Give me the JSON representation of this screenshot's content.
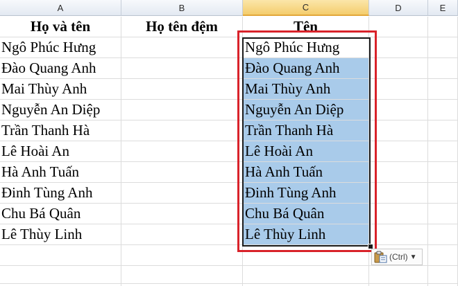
{
  "columns": [
    "A",
    "B",
    "C",
    "D",
    "E"
  ],
  "header_row": {
    "a": "Họ và tên",
    "b": "Họ tên đệm",
    "c": "Tên"
  },
  "rows": [
    {
      "a": "Ngô Phúc Hưng",
      "c": "Ngô Phúc Hưng"
    },
    {
      "a": "Đào Quang Anh",
      "c": "Đào Quang Anh"
    },
    {
      "a": "Mai Thùy Anh",
      "c": "Mai Thùy Anh"
    },
    {
      "a": "Nguyễn An Diệp",
      "c": "Nguyễn An Diệp"
    },
    {
      "a": "Trần Thanh Hà",
      "c": "Trần Thanh Hà"
    },
    {
      "a": "Lê Hoài An",
      "c": "Lê Hoài An"
    },
    {
      "a": "Hà Anh Tuấn",
      "c": "Hà Anh Tuấn"
    },
    {
      "a": "Đinh Tùng Anh",
      "c": "Đinh Tùng Anh"
    },
    {
      "a": "Chu Bá Quân",
      "c": "Chu Bá Quân"
    },
    {
      "a": "Lê Thùy Linh",
      "c": "Lê Thùy Linh"
    }
  ],
  "paste_options": {
    "label": "(Ctrl)",
    "icon": "clipboard-icon"
  },
  "colors": {
    "selection_fill": "#a9cbea",
    "highlight_box": "#d9222a",
    "selected_column_header": "#f4cd6d"
  }
}
